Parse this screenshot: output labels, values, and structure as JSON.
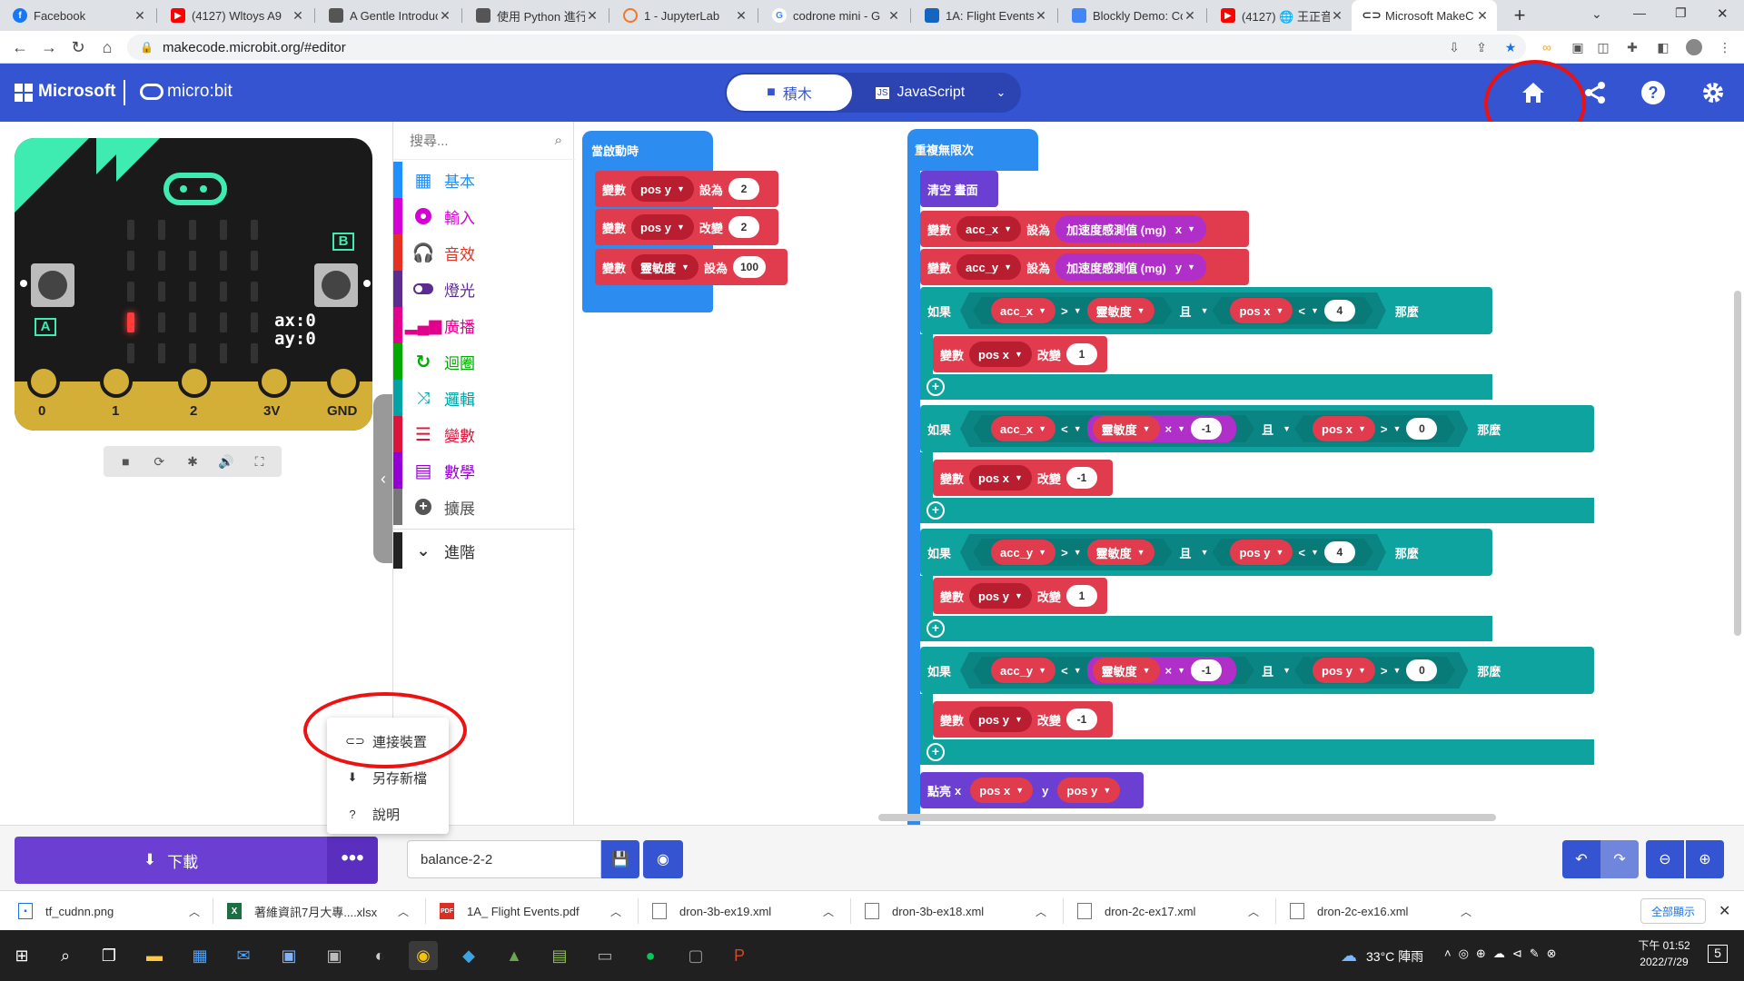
{
  "browser": {
    "tabs": [
      {
        "title": "Facebook",
        "favicon": "facebook-icon",
        "color": "#1877f2"
      },
      {
        "title": "(4127) Wltoys A9",
        "favicon": "youtube-icon",
        "color": "#ff0000"
      },
      {
        "title": "A Gentle Introduc",
        "favicon": "page-icon",
        "color": "#555555"
      },
      {
        "title": "使用 Python 進行",
        "favicon": "page-icon",
        "color": "#555555"
      },
      {
        "title": "1 - JupyterLab",
        "favicon": "jupyter-icon",
        "color": "#f37726"
      },
      {
        "title": "codrone mini - G",
        "favicon": "google-icon",
        "color": "#4285f4"
      },
      {
        "title": "1A: Flight Events",
        "favicon": "drone-icon",
        "color": "#1565c0"
      },
      {
        "title": "Blockly Demo: Co",
        "favicon": "blockly-icon",
        "color": "#4285f4"
      },
      {
        "title": "(4127) 🌐 王正音",
        "favicon": "youtube-icon",
        "color": "#ff0000"
      },
      {
        "title": "Microsoft MakeC",
        "favicon": "makecode-icon",
        "color": "#333333"
      }
    ],
    "new_tab": "+",
    "url": "makecode.microbit.org/#editor"
  },
  "header": {
    "brand": "Microsoft",
    "product": "micro:bit",
    "blocks_tab": "積木",
    "js_tab": "JavaScript",
    "color": "#3454d1"
  },
  "simulator": {
    "ax": "ax:0",
    "ay": "ay:0",
    "button_a": "A",
    "button_b": "B",
    "pins": [
      "0",
      "1",
      "2",
      "3V",
      "GND"
    ]
  },
  "toolbox": {
    "search_placeholder": "搜尋...",
    "categories": [
      {
        "label": "基本",
        "color": "#1e90ff",
        "icon": "grid-icon"
      },
      {
        "label": "輸入",
        "color": "#d400d4",
        "icon": "input-circle-icon"
      },
      {
        "label": "音效",
        "color": "#e63022",
        "icon": "headphones-icon"
      },
      {
        "label": "燈光",
        "color": "#5c2d91",
        "icon": "toggle-icon"
      },
      {
        "label": "廣播",
        "color": "#e3008c",
        "icon": "signal-bars-icon"
      },
      {
        "label": "迴圈",
        "color": "#00aa00",
        "icon": "refresh-icon"
      },
      {
        "label": "邏輯",
        "color": "#00a4a6",
        "icon": "shuffle-icon"
      },
      {
        "label": "變數",
        "color": "#dc143c",
        "icon": "lines-icon"
      },
      {
        "label": "數學",
        "color": "#9400d3",
        "icon": "calculator-icon"
      },
      {
        "label": "擴展",
        "color": "#777777",
        "icon": "plus-circle-icon"
      }
    ],
    "advanced": "進階"
  },
  "blocks": {
    "on_start": {
      "hat": "當啟動時",
      "rows": [
        {
          "kw": "變數",
          "var": "pos y",
          "op": "設為",
          "value": "2"
        },
        {
          "kw": "變數",
          "var": "pos y",
          "op": "改變",
          "value": "2"
        },
        {
          "kw": "變數",
          "var": "靈敏度",
          "op": "設為",
          "value": "100"
        }
      ]
    },
    "forever": {
      "hat": "重複無限次",
      "clear": "清空 畫面",
      "set_acc_x": {
        "kw": "變數",
        "var": "acc_x",
        "op": "設為",
        "reading": "加速度感測值 (mg)",
        "axis": "x"
      },
      "set_acc_y": {
        "kw": "變數",
        "var": "acc_y",
        "op": "設為",
        "reading": "加速度感測值 (mg)",
        "axis": "y"
      },
      "if_kw": "如果",
      "then_kw": "那麼",
      "and_kw": "且",
      "ifs": [
        {
          "left": "acc_x",
          "cmp": ">",
          "right": "靈敏度",
          "neg": "",
          "var": "pos x",
          "cmp2": "<",
          "val2": "4",
          "body_var": "pos x",
          "body_op": "改變",
          "body_val": "1"
        },
        {
          "left": "acc_x",
          "cmp": "<",
          "right": "靈敏度",
          "neg": "-1",
          "var": "pos x",
          "cmp2": ">",
          "val2": "0",
          "body_var": "pos x",
          "body_op": "改變",
          "body_val": "-1"
        },
        {
          "left": "acc_y",
          "cmp": ">",
          "right": "靈敏度",
          "neg": "",
          "var": "pos y",
          "cmp2": "<",
          "val2": "4",
          "body_var": "pos y",
          "body_op": "改變",
          "body_val": "1"
        },
        {
          "left": "acc_y",
          "cmp": "<",
          "right": "靈敏度",
          "neg": "-1",
          "var": "pos y",
          "cmp2": ">",
          "val2": "0",
          "body_var": "pos y",
          "body_op": "改變",
          "body_val": "-1"
        }
      ],
      "times": "×",
      "plot": {
        "kw": "點亮",
        "x_kw": "x",
        "x_var": "pos x",
        "y_kw": "y",
        "y_var": "pos y"
      }
    }
  },
  "bottom": {
    "download": "下載",
    "more": "•••",
    "project_name": "balance-2-2"
  },
  "popup_menu": [
    {
      "label": "連接裝置",
      "icon": "link-icon"
    },
    {
      "label": "另存新檔",
      "icon": "save-as-icon"
    },
    {
      "label": "說明",
      "icon": "help-icon"
    }
  ],
  "downloads": [
    {
      "name": "tf_cudnn.png",
      "type": "png"
    },
    {
      "name": "著維資訊7月大專....xlsx",
      "type": "xlsx"
    },
    {
      "name": "1A_ Flight Events.pdf",
      "type": "pdf"
    },
    {
      "name": "dron-3b-ex19.xml",
      "type": "xml"
    },
    {
      "name": "dron-3b-ex18.xml",
      "type": "xml"
    },
    {
      "name": "dron-2c-ex17.xml",
      "type": "xml"
    },
    {
      "name": "dron-2c-ex16.xml",
      "type": "xml"
    }
  ],
  "show_all": "全部顯示",
  "taskbar": {
    "weather": "33°C 陣雨",
    "time": "下午 01:52",
    "date": "2022/7/29",
    "notifications": "5"
  }
}
